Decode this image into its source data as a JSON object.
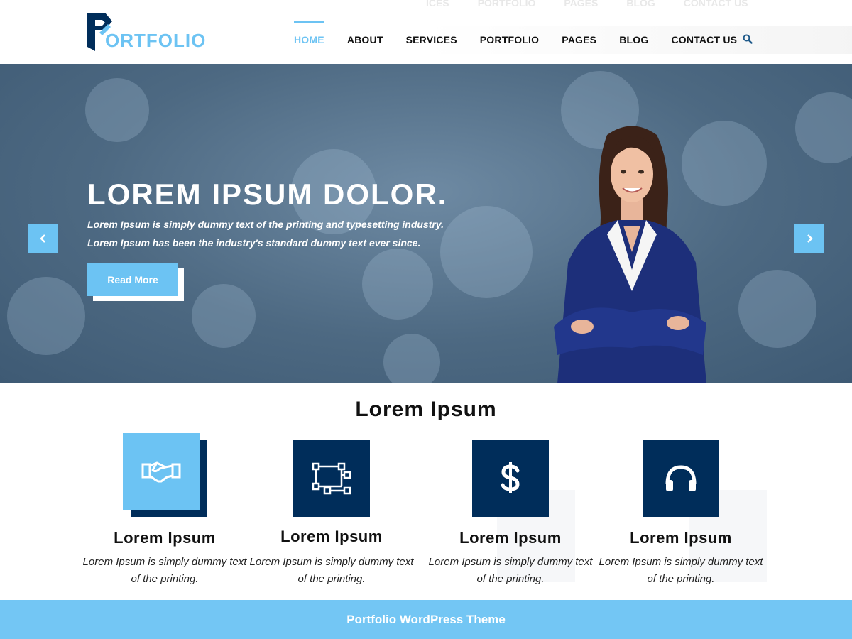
{
  "header": {
    "logo_text": "ORTFOLIO",
    "nav": [
      "HOME",
      "ABOUT",
      "SERVICES",
      "PORTFOLIO",
      "PAGES",
      "BLOG",
      "CONTACT US"
    ],
    "active_nav": "HOME",
    "ghost_nav": [
      "ICES",
      "PORTFOLIO",
      "PAGES",
      "BLOG",
      "CONTACT US"
    ]
  },
  "hero": {
    "title": "LOREM IPSUM DOLOR.",
    "text": "Lorem Ipsum is simply dummy text of the printing and typesetting industry. Lorem Ipsum has been the industry's standard dummy text ever since.",
    "button": "Read More"
  },
  "services": {
    "title": "Lorem Ipsum",
    "items": [
      {
        "icon": "handshake-icon",
        "title": "Lorem Ipsum",
        "text": "Lorem Ipsum is simply dummy text of the printing."
      },
      {
        "icon": "vector-nodes-icon",
        "title": "Lorem Ipsum",
        "text": "Lorem Ipsum is simply dummy text of the printing."
      },
      {
        "icon": "dollar-icon",
        "title": "Lorem Ipsum",
        "text": "Lorem Ipsum is simply dummy text of the printing."
      },
      {
        "icon": "headphones-icon",
        "title": "Lorem Ipsum",
        "text": "Lorem Ipsum is simply dummy text of the printing."
      }
    ]
  },
  "footer": {
    "text": "Portfolio WordPress Theme"
  },
  "colors": {
    "accent": "#6cc3f3",
    "navy": "#002d5a",
    "footer": "#73c6f4"
  }
}
